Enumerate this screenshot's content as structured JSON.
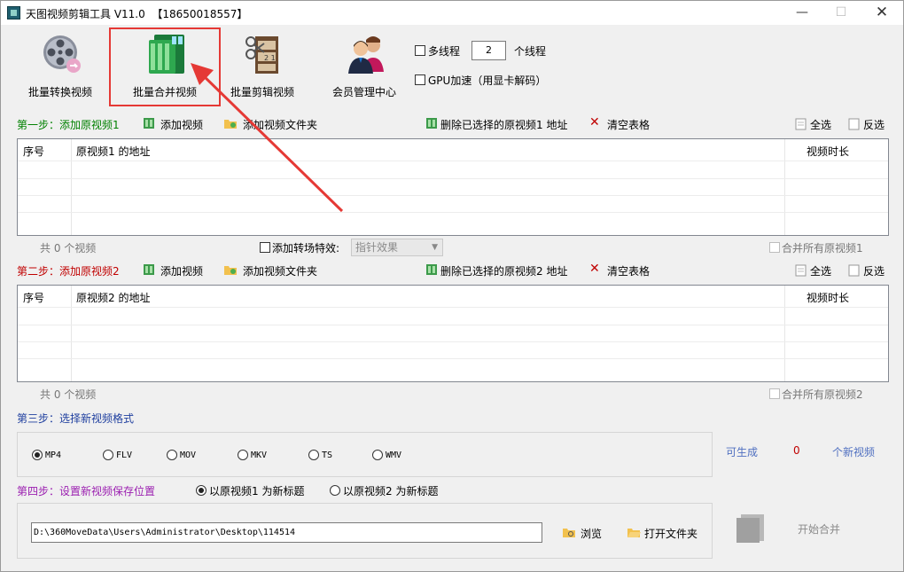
{
  "window": {
    "title": "天图视频剪辑工具 V11.0  【18650018557】",
    "minimize": "—",
    "maximize": "☐",
    "close": "✕"
  },
  "toolbar": {
    "tools": [
      {
        "label": "批量转换视频",
        "icon": "film-reel-convert-icon"
      },
      {
        "label": "批量合并视频",
        "icon": "merge-video-icon"
      },
      {
        "label": "批量剪辑视频",
        "icon": "film-strip-cut-icon"
      },
      {
        "label": "会员管理中心",
        "icon": "members-icon"
      }
    ],
    "multithread_label": "多线程",
    "thread_count": "2",
    "thread_unit": "个线程",
    "gpu_label": "GPU加速（用显卡解码）"
  },
  "step1": {
    "title": "第一步：添加原视频1",
    "add_video": "添加视频",
    "add_folder": "添加视频文件夹",
    "delete_selected": "删除已选择的原视频1 地址",
    "clear_table": "清空表格",
    "select_all": "全选",
    "invert": "反选",
    "col_index": "序号",
    "col_path": "原视频1 的地址",
    "col_duration": "视频时长",
    "count": "共 0 个视频",
    "transition_label": "添加转场特效:",
    "transition_value": "指针效果",
    "merge_all": "合并所有原视频1"
  },
  "step2": {
    "title": "第二步：添加原视频2",
    "add_video": "添加视频",
    "add_folder": "添加视频文件夹",
    "delete_selected": "删除已选择的原视频2 地址",
    "clear_table": "清空表格",
    "select_all": "全选",
    "invert": "反选",
    "col_index": "序号",
    "col_path": "原视频2 的地址",
    "col_duration": "视频时长",
    "count": "共 0 个视频",
    "merge_all": "合并所有原视频2"
  },
  "step3": {
    "title": "第三步：选择新视频格式",
    "formats": [
      "MP4",
      "FLV",
      "MOV",
      "MKV",
      "TS",
      "WMV"
    ],
    "selected_format": "MP4",
    "can_generate_label": "可生成",
    "can_generate_count": "0",
    "new_videos_label": "个新视频"
  },
  "step4": {
    "title": "第四步：设置新视频保存位置",
    "title_option1": "以原视频1 为新标题",
    "title_option2": "以原视频2 为新标题",
    "save_path": "D:\\360MoveData\\Users\\Administrator\\Desktop\\114514",
    "browse": "浏览",
    "open_folder": "打开文件夹",
    "start_merge": "开始合并"
  },
  "colors": {
    "highlight_box": "#e53935",
    "annotation_arrow": "#e53935",
    "step1_title": "#008000",
    "step2_title": "#c00000",
    "step3_title": "#1f3f9f",
    "step4_title": "#9b1fb0"
  }
}
